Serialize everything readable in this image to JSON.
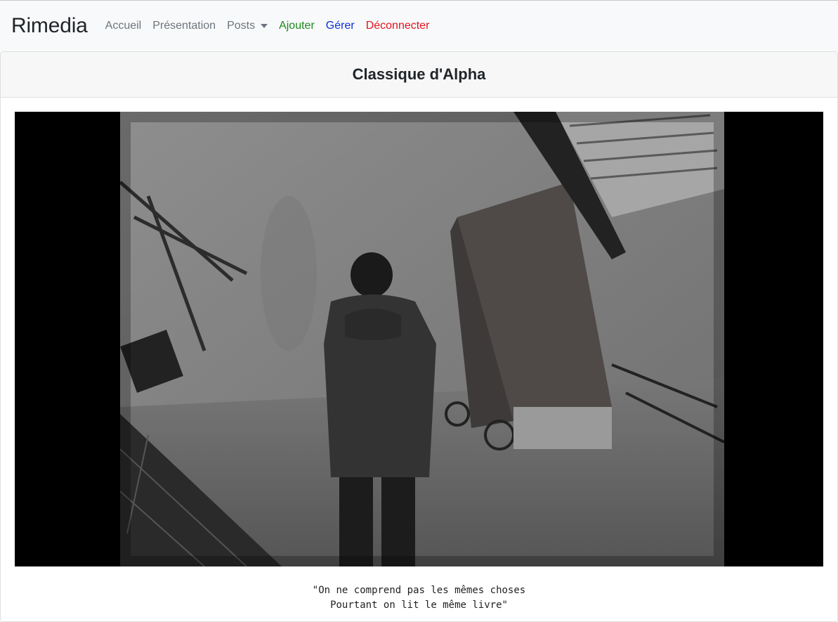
{
  "navbar": {
    "brand": "Rimedia",
    "items": [
      {
        "label": "Accueil",
        "color": "#6c757d"
      },
      {
        "label": "Présentation",
        "color": "#6c757d"
      },
      {
        "label": "Posts",
        "color": "#6c757d",
        "dropdown": true
      },
      {
        "label": "Ajouter",
        "color": "#1e8a1e"
      },
      {
        "label": "Gérer",
        "color": "#0d2fd6"
      },
      {
        "label": "Déconnecter",
        "color": "#e3141e"
      }
    ]
  },
  "card": {
    "title": "Classique d'Alpha",
    "caption_line1": "\"On ne comprend pas les mêmes choses",
    "caption_line2": "Pourtant on lit le même livre\""
  }
}
